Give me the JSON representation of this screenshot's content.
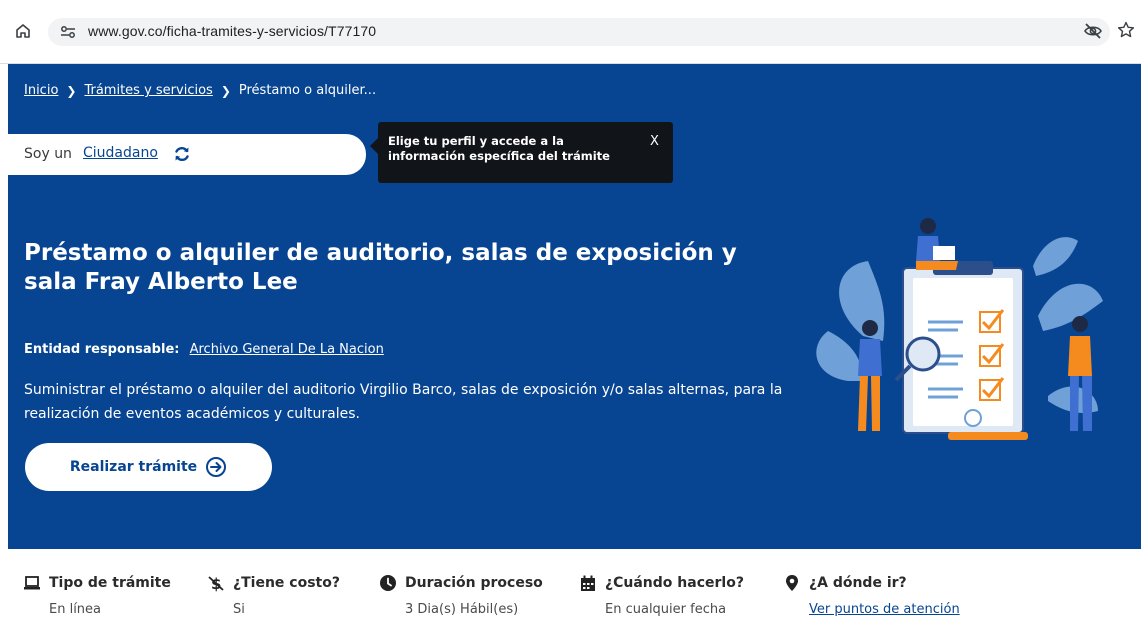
{
  "browser": {
    "url": "www.gov.co/ficha-tramites-y-servicios/T77170",
    "icons": [
      "home-icon",
      "site-settings-icon",
      "eye-off-icon",
      "star-icon"
    ]
  },
  "breadcrumb": {
    "items": [
      "Inicio",
      "Trámites y servicios",
      "Préstamo o alquiler..."
    ]
  },
  "profile": {
    "prefix": "Soy un",
    "role": "Ciudadano"
  },
  "tooltip": {
    "text": "Elige tu perfil y accede a la información específica del trámite",
    "close": "X"
  },
  "page": {
    "title": "Préstamo o alquiler de auditorio, salas de exposición y sala Fray Alberto Lee",
    "entity_label": "Entidad responsable:",
    "entity_name": "Archivo General De La Nacion",
    "description": "Suministrar el préstamo o alquiler del auditorio Virgilio Barco, salas de exposición y/o salas alternas, para la realización de eventos académicos y culturales.",
    "cta_label": "Realizar trámite"
  },
  "info": {
    "items": [
      {
        "icon": "laptop-icon",
        "label": "Tipo de trámite",
        "value": "En línea"
      },
      {
        "icon": "cost-icon",
        "label": "¿Tiene costo?",
        "value": "Si"
      },
      {
        "icon": "clock-icon",
        "label": "Duración proceso",
        "value": "3 Dia(s) Hábil(es)"
      },
      {
        "icon": "calendar-icon",
        "label": "¿Cuándo hacerlo?",
        "value": "En cualquier fecha"
      },
      {
        "icon": "location-icon",
        "label": "¿A dónde ir?",
        "value": "Ver puntos de atención"
      }
    ]
  },
  "colors": {
    "hero_bg": "#074592",
    "tooltip_bg": "#111418",
    "accent_orange": "#f58b1f",
    "leaf_blue": "#6fa0d8"
  }
}
